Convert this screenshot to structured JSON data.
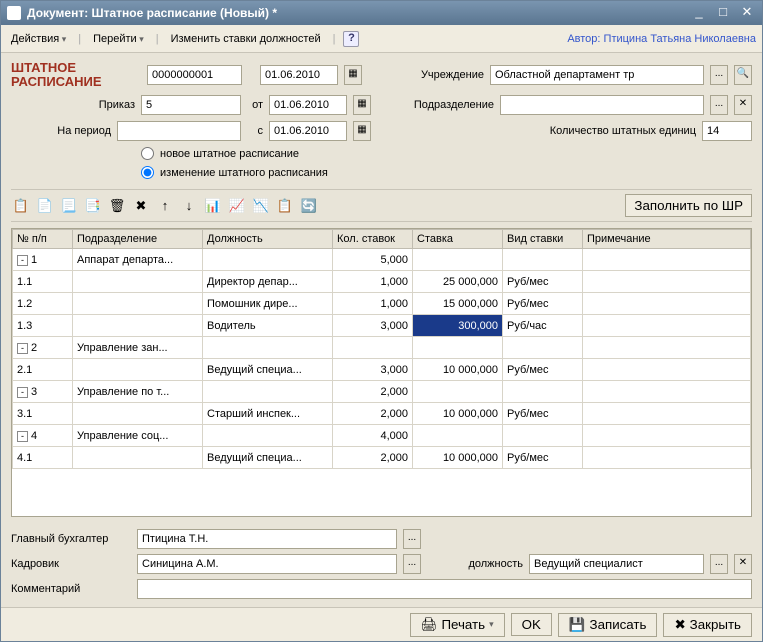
{
  "window": {
    "title": "Документ: Штатное расписание (Новый) *"
  },
  "menu": {
    "actions": "Действия",
    "goto": "Перейти",
    "rates": "Изменить ставки должностей",
    "author_label": "Автор:",
    "author": "Птицина Татьяна Николаевна"
  },
  "header": {
    "title_line1": "ШТАТНОЕ",
    "title_line2": "РАСПИСАНИЕ",
    "number": "0000000001",
    "date": "01.06.2010",
    "inst_label": "Учреждение",
    "inst_value": "Областной департамент тр",
    "prikaz_label": "Приказ",
    "prikaz_value": "5",
    "ot_label": "от",
    "ot_date": "01.06.2010",
    "subdiv_label": "Подразделение",
    "subdiv_value": "",
    "period_label": "На период",
    "period_value": "",
    "s_label": "с",
    "s_date": "01.06.2010",
    "count_label": "Количество штатных единиц",
    "count_value": "14",
    "radio_new": "новое штатное расписание",
    "radio_change": "изменение штатного расписания"
  },
  "toolbar": {
    "fill": "Заполнить по ШР"
  },
  "grid": {
    "cols": [
      "№ п/п",
      "Подразделение",
      "Должность",
      "Кол. ставок",
      "Ставка",
      "Вид ставки",
      "Примечание"
    ],
    "rows": [
      {
        "tree": "-",
        "n": "1",
        "dept": "Аппарат департа...",
        "pos": "",
        "cnt": "5,000",
        "rate": "",
        "kind": "",
        "note": ""
      },
      {
        "tree": "",
        "n": "1.1",
        "dept": "",
        "pos": "Директор депар...",
        "cnt": "1,000",
        "rate": "25 000,000",
        "kind": "Руб/мес",
        "note": ""
      },
      {
        "tree": "",
        "n": "1.2",
        "dept": "",
        "pos": "Помошник дире...",
        "cnt": "1,000",
        "rate": "15 000,000",
        "kind": "Руб/мес",
        "note": ""
      },
      {
        "tree": "",
        "n": "1.3",
        "dept": "",
        "pos": "Водитель",
        "cnt": "3,000",
        "rate": "300,000",
        "kind": "Руб/час",
        "note": "",
        "sel": true
      },
      {
        "tree": "-",
        "n": "2",
        "dept": "Управление зан...",
        "pos": "",
        "cnt": "",
        "rate": "",
        "kind": "",
        "note": ""
      },
      {
        "tree": "",
        "n": "2.1",
        "dept": "",
        "pos": "Ведущий специа...",
        "cnt": "3,000",
        "rate": "10 000,000",
        "kind": "Руб/мес",
        "note": ""
      },
      {
        "tree": "-",
        "n": "3",
        "dept": "Управление по т...",
        "pos": "",
        "cnt": "2,000",
        "rate": "",
        "kind": "",
        "note": ""
      },
      {
        "tree": "",
        "n": "3.1",
        "dept": "",
        "pos": "Старший инспек...",
        "cnt": "2,000",
        "rate": "10 000,000",
        "kind": "Руб/мес",
        "note": ""
      },
      {
        "tree": "-",
        "n": "4",
        "dept": "Управление соц...",
        "pos": "",
        "cnt": "4,000",
        "rate": "",
        "kind": "",
        "note": ""
      },
      {
        "tree": "",
        "n": "4.1",
        "dept": "",
        "pos": "Ведущий специа...",
        "cnt": "2,000",
        "rate": "10 000,000",
        "kind": "Руб/мес",
        "note": ""
      }
    ]
  },
  "footer": {
    "accountant_label": "Главный бухгалтер",
    "accountant_value": "Птицина Т.Н.",
    "hr_label": "Кадровик",
    "hr_value": "Синицина А.М.",
    "position_label": "должность",
    "position_value": "Ведущий специалист",
    "comment_label": "Комментарий",
    "comment_value": ""
  },
  "actions": {
    "print": "Печать",
    "ok": "OK",
    "save": "Записать",
    "close": "Закрыть"
  },
  "icons": {
    "tb": [
      "📋",
      "📄",
      "📃",
      "📑",
      "🗑",
      "✖",
      "↑",
      "↓",
      "📊",
      "📈",
      "📉",
      "📋",
      "🔄"
    ],
    "print": "🖨",
    "save": "💾",
    "close": "✖"
  }
}
